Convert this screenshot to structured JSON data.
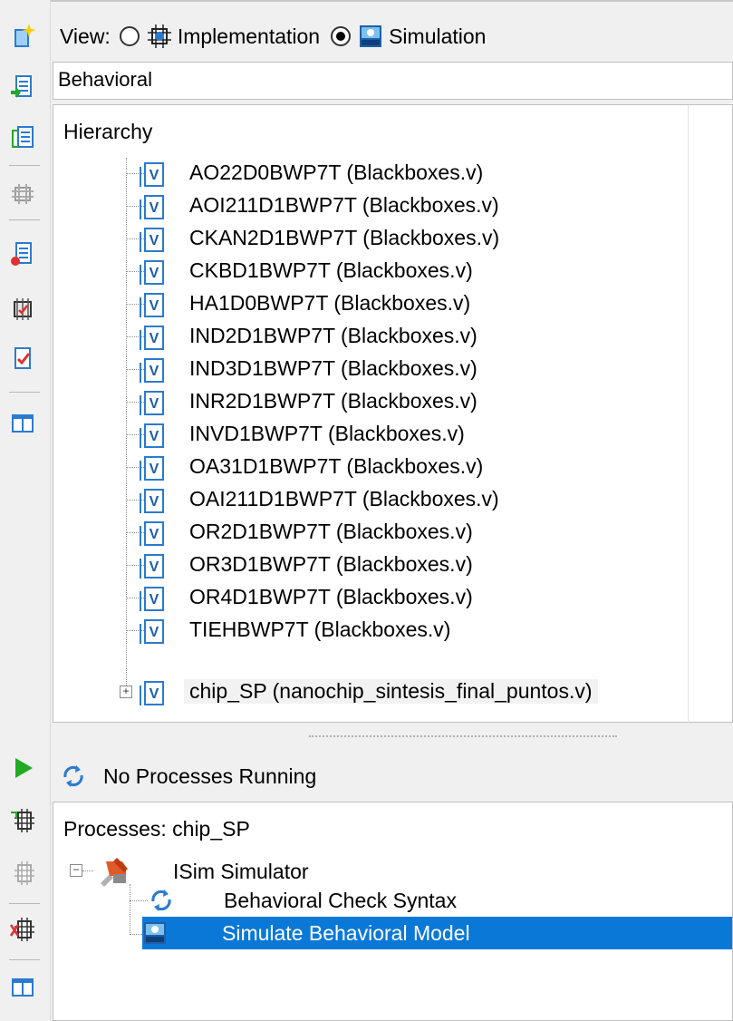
{
  "view": {
    "label": "View:",
    "options": [
      {
        "label": "Implementation",
        "selected": false
      },
      {
        "label": "Simulation",
        "selected": true
      }
    ]
  },
  "design_view": "Behavioral",
  "hierarchy": {
    "title": "Hierarchy",
    "items": [
      {
        "text": "AO22D0BWP7T (Blackboxes.v)"
      },
      {
        "text": "AOI211D1BWP7T (Blackboxes.v)"
      },
      {
        "text": "CKAN2D1BWP7T (Blackboxes.v)"
      },
      {
        "text": "CKBD1BWP7T (Blackboxes.v)"
      },
      {
        "text": "HA1D0BWP7T (Blackboxes.v)"
      },
      {
        "text": "IND2D1BWP7T (Blackboxes.v)"
      },
      {
        "text": "IND3D1BWP7T (Blackboxes.v)"
      },
      {
        "text": "INR2D1BWP7T (Blackboxes.v)"
      },
      {
        "text": "INVD1BWP7T (Blackboxes.v)"
      },
      {
        "text": "OA31D1BWP7T (Blackboxes.v)"
      },
      {
        "text": "OAI211D1BWP7T (Blackboxes.v)"
      },
      {
        "text": "OR2D1BWP7T (Blackboxes.v)"
      },
      {
        "text": "OR3D1BWP7T (Blackboxes.v)"
      },
      {
        "text": "OR4D1BWP7T (Blackboxes.v)"
      },
      {
        "text": "TIEHBWP7T (Blackboxes.v)"
      },
      {
        "text": "chip_SP (nanochip_sintesis_final_puntos.v)",
        "expandable": true,
        "selected": true
      }
    ],
    "file_icon_letter": "V"
  },
  "processes": {
    "status": "No Processes Running",
    "title": "Processes: chip_SP",
    "tree": {
      "root": "ISim Simulator",
      "children": [
        {
          "text": "Behavioral Check Syntax",
          "icon": "refresh-icon"
        },
        {
          "text": "Simulate Behavioral Model",
          "icon": "isim-icon",
          "selected": true
        }
      ]
    }
  },
  "colors": {
    "selection": "#0a78d7",
    "file_icon": "#2a7bd0",
    "panel_bg": "#f0f0f0"
  }
}
